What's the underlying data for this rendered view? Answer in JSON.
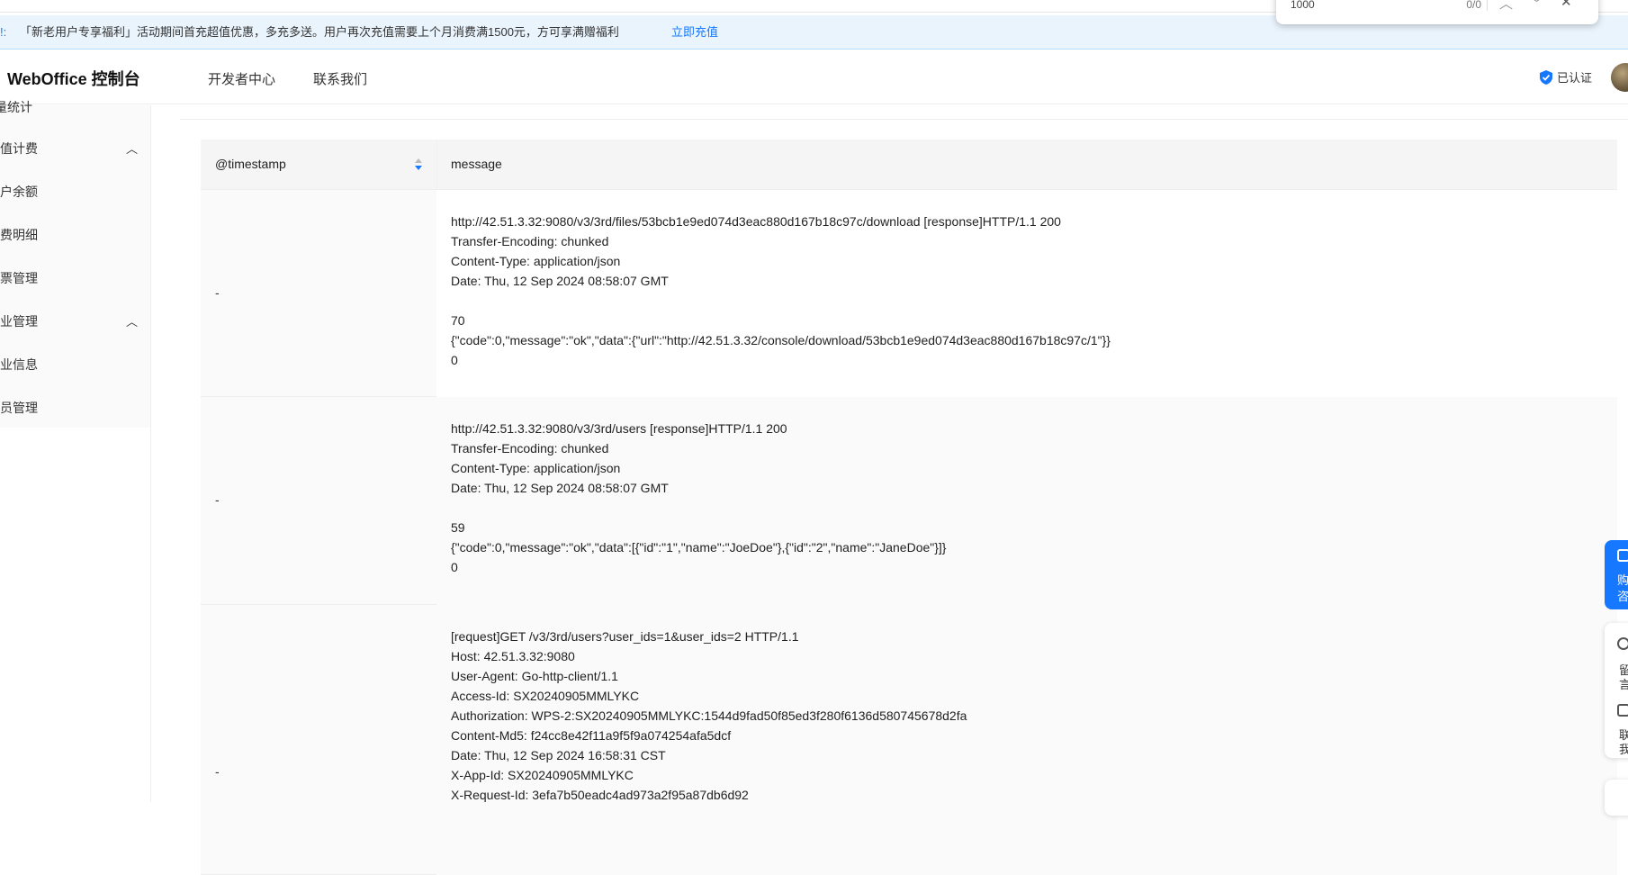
{
  "findbar": {
    "query": "1000",
    "count": "0/0"
  },
  "banner": {
    "lead": "!:",
    "text": "「新老用户专享福利」活动期间首充超值优惠，多充多送。用户再次充值需要上个月消费满1500元，方可享满赠福利",
    "link": "立即充值"
  },
  "header": {
    "logo": "WebOffice 控制台",
    "nav": [
      "开发者中心",
      "联系我们"
    ],
    "verified": "已认证"
  },
  "sidebar": {
    "items": [
      {
        "label": "量统计"
      },
      {
        "label": "充值计费",
        "group": true
      },
      {
        "label": "账户余额"
      },
      {
        "label": "消费明细"
      },
      {
        "label": "发票管理"
      },
      {
        "label": "企业管理",
        "group": true
      },
      {
        "label": "企业信息"
      },
      {
        "label": "成员管理"
      }
    ]
  },
  "table": {
    "columns": [
      "@timestamp",
      "message"
    ],
    "rows": [
      {
        "timestamp": "-",
        "message": "http://42.51.3.32:9080/v3/3rd/files/53bcb1e9ed074d3eac880d167b18c97c/download [response]HTTP/1.1 200\nTransfer-Encoding: chunked\nContent-Type: application/json\nDate: Thu, 12 Sep 2024 08:58:07 GMT\n\n70\n{\"code\":0,\"message\":\"ok\",\"data\":{\"url\":\"http://42.51.3.32/console/download/53bcb1e9ed074d3eac880d167b18c97c/1\"}}\n0"
      },
      {
        "timestamp": "-",
        "message": "http://42.51.3.32:9080/v3/3rd/users [response]HTTP/1.1 200\nTransfer-Encoding: chunked\nContent-Type: application/json\nDate: Thu, 12 Sep 2024 08:58:07 GMT\n\n59\n{\"code\":0,\"message\":\"ok\",\"data\":[{\"id\":\"1\",\"name\":\"JoeDoe\"},{\"id\":\"2\",\"name\":\"JaneDoe\"}]}\n0"
      },
      {
        "timestamp": "-",
        "message": "[request]GET /v3/3rd/users?user_ids=1&user_ids=2 HTTP/1.1\nHost: 42.51.3.32:9080\nUser-Agent: Go-http-client/1.1\nAccess-Id: SX20240905MMLYKC\nAuthorization: WPS-2:SX20240905MMLYKC:1544d9fad50f85ed3f280f6136d580745678d2fa\nContent-Md5: f24cc8e42f11a9f5f9a074254afa5dcf\nDate: Thu, 12 Sep 2024 16:58:31 CST\nX-App-Id: SX20240905MMLYKC\nX-Request-Id: 3efa7b50eadc4ad973a2f95a87db6d92"
      }
    ]
  },
  "float": {
    "consult_1": "购",
    "consult_2": "咨",
    "msg_1": "留",
    "msg_2": "言",
    "contact_1": "联",
    "contact_2": "我"
  },
  "colors": {
    "accent": "#1677ff",
    "banner_bg": "#eaf4fd"
  }
}
